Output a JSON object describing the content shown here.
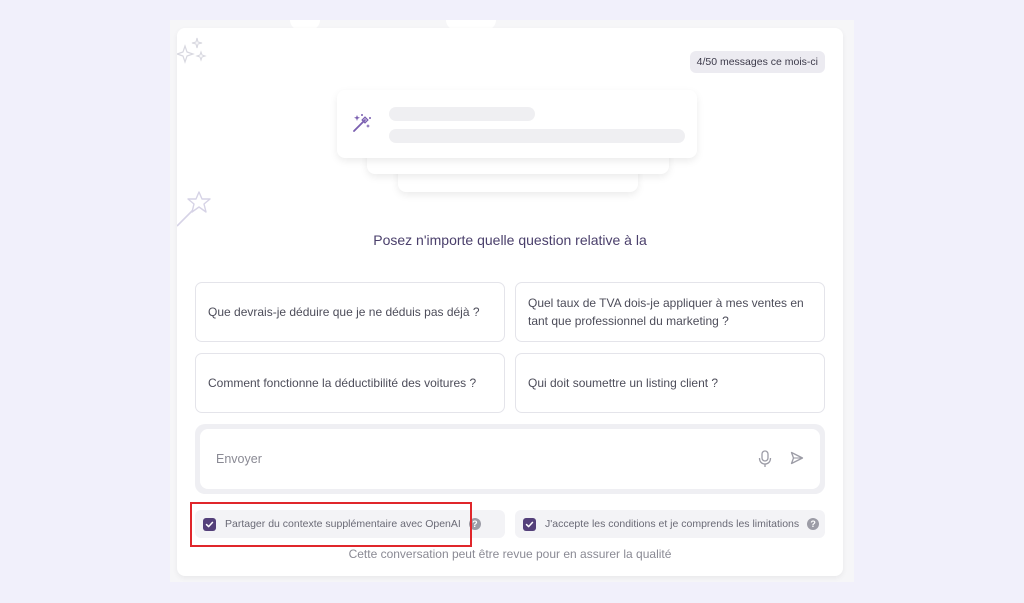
{
  "usage_badge": "4/50 messages ce mois-ci",
  "headline": "Posez n'importe quelle question relative à la",
  "suggestions": [
    "Que devrais-je déduire que je ne déduis pas déjà ?",
    "Quel taux de TVA dois-je appliquer à mes ventes en tant que professionnel du marketing ?",
    "Comment fonctionne la déductibilité des voitures ?",
    "Qui doit soumettre un listing client ?"
  ],
  "composer": {
    "placeholder": "Envoyer",
    "mic_icon": "microphone-icon",
    "send_icon": "send-icon"
  },
  "options": {
    "share_context": {
      "label": "Partager du contexte supplémentaire avec OpenAI",
      "checked": true
    },
    "accept_terms": {
      "label": "J'accepte les conditions et je comprends les limitations",
      "checked": true
    }
  },
  "footer_note": "Cette conversation peut être revue pour en assurer la qualité",
  "colors": {
    "accent": "#54407a",
    "headline": "#4a3f6b",
    "highlight": "#e0262b",
    "background": "#f1f0fb"
  }
}
